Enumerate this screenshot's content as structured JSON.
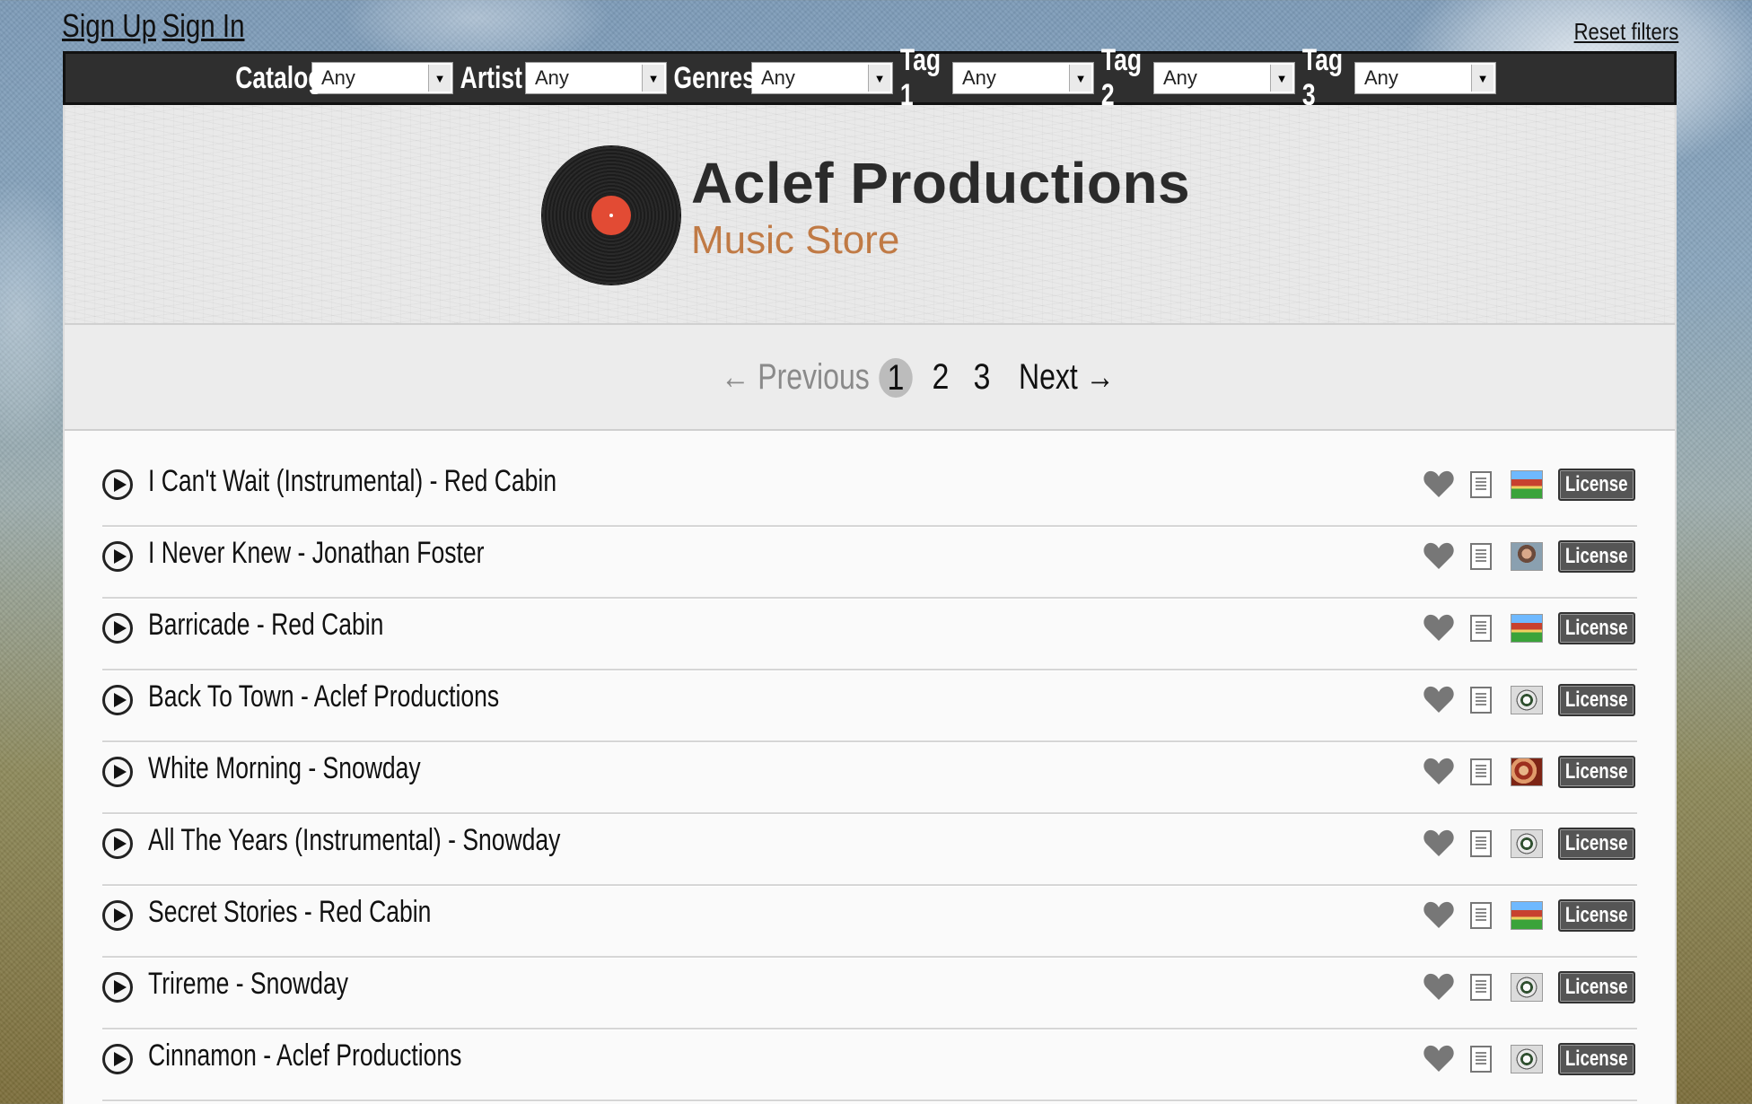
{
  "auth": {
    "sign_up": "Sign Up",
    "sign_in": "Sign In",
    "reset_filters": "Reset filters"
  },
  "filters": [
    {
      "label": "Catalog",
      "value": "Any"
    },
    {
      "label": "Artist",
      "value": "Any"
    },
    {
      "label": "Genres",
      "value": "Any"
    },
    {
      "label": "Tag 1",
      "value": "Any"
    },
    {
      "label": "Tag 2",
      "value": "Any"
    },
    {
      "label": "Tag 3",
      "value": "Any"
    }
  ],
  "brand": {
    "title": "Aclef Productions",
    "subtitle": "Music Store",
    "accent_color": "#c07a45",
    "record_label_color": "#e24b34"
  },
  "pagination": {
    "previous": "← Previous",
    "pages": [
      "1",
      "2",
      "3"
    ],
    "current_page": "1",
    "next": "Next →"
  },
  "tracks": [
    {
      "title": "I Can't Wait (Instrumental) - Red Cabin",
      "thumb": "barn-thumbnail",
      "license": "License"
    },
    {
      "title": "I Never Knew - Jonathan Foster",
      "thumb": "person-thumbnail",
      "license": "License"
    },
    {
      "title": "Barricade - Red Cabin",
      "thumb": "barn-thumbnail",
      "license": "License"
    },
    {
      "title": "Back To Town - Aclef Productions",
      "thumb": "logo-thumbnail",
      "license": "License"
    },
    {
      "title": "White Morning - Snowday",
      "thumb": "swirl-thumbnail",
      "license": "License"
    },
    {
      "title": "All The Years (Instrumental) - Snowday",
      "thumb": "logo-thumbnail",
      "license": "License"
    },
    {
      "title": "Secret Stories - Red Cabin",
      "thumb": "barn-thumbnail",
      "license": "License"
    },
    {
      "title": "Trireme - Snowday",
      "thumb": "logo-thumbnail",
      "license": "License"
    },
    {
      "title": "Cinnamon - Aclef Productions",
      "thumb": "logo-thumbnail",
      "license": "License"
    }
  ]
}
